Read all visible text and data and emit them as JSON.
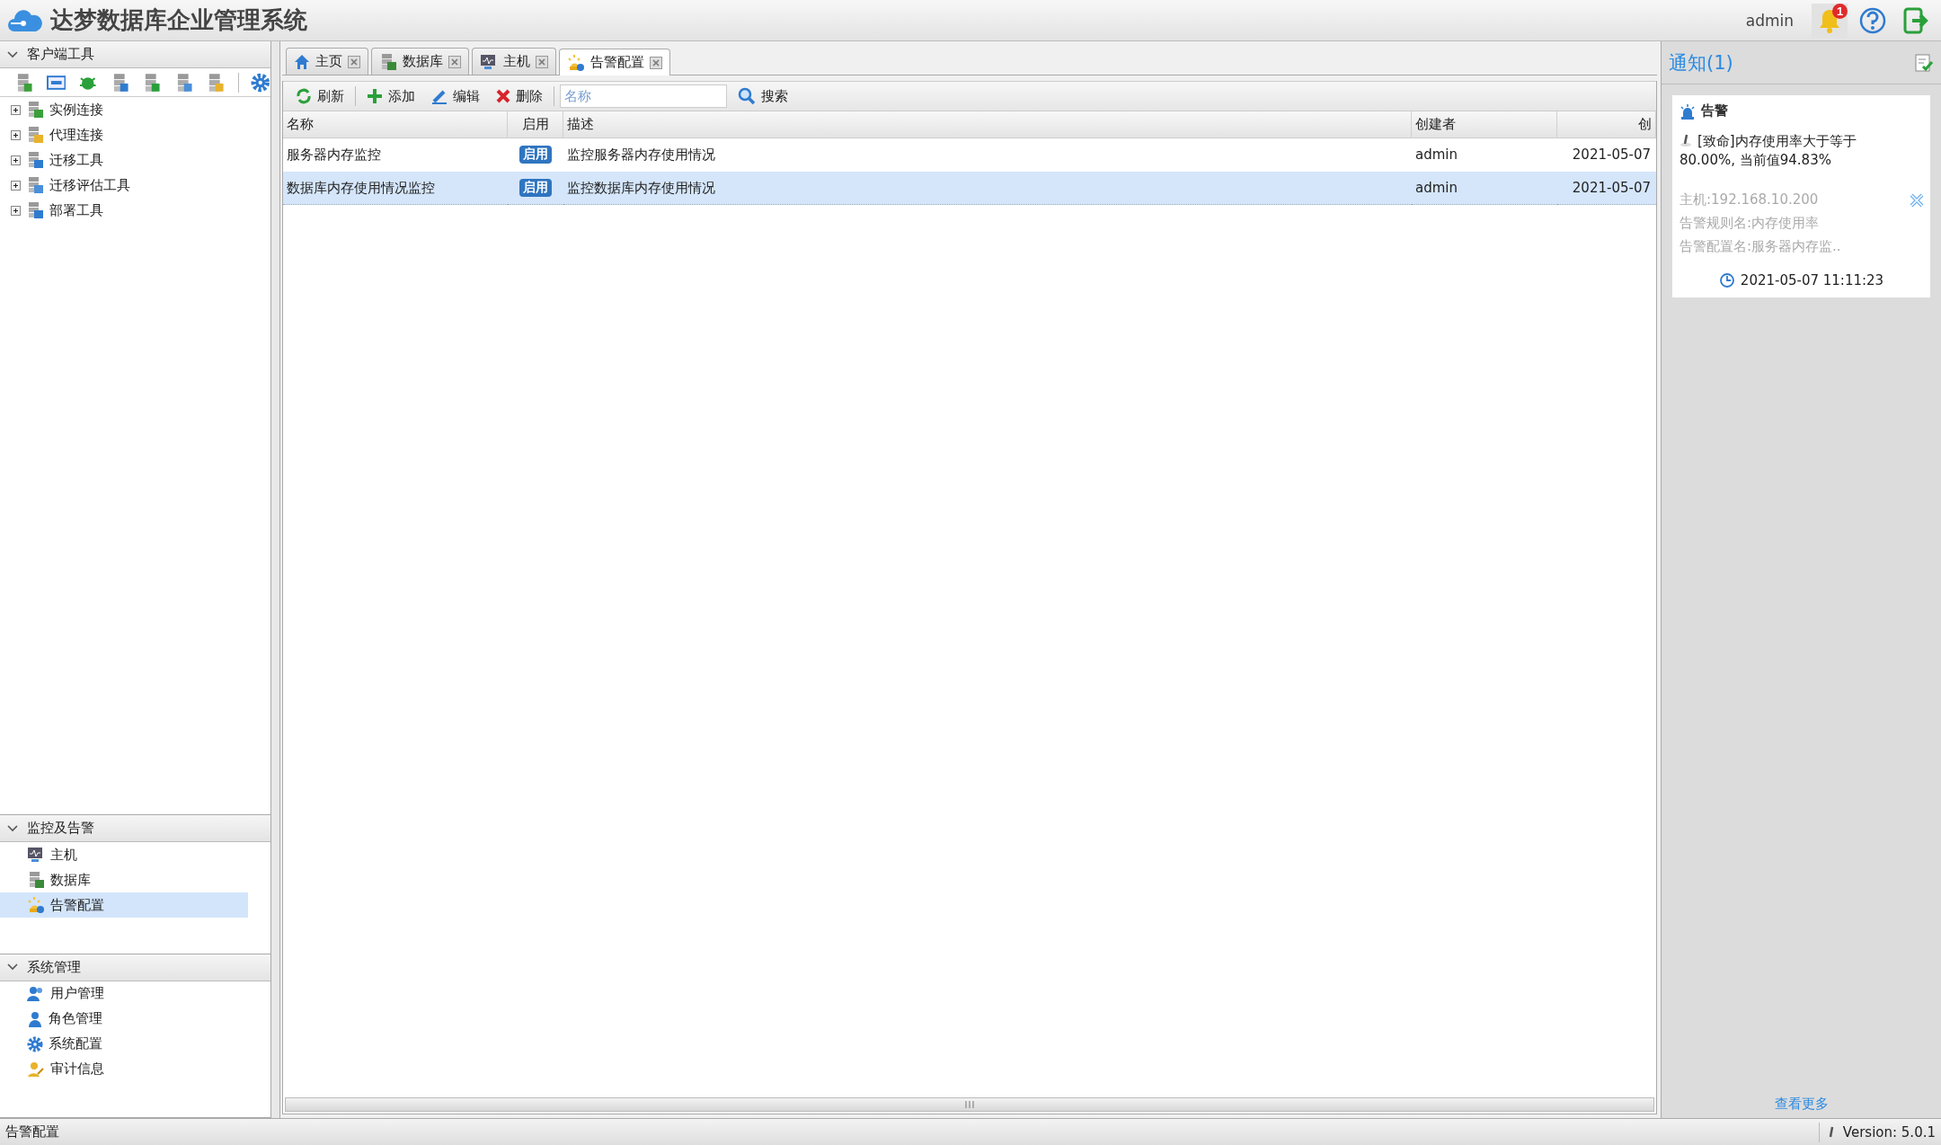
{
  "app": {
    "title": "达梦数据库企业管理系统",
    "user": "admin",
    "notification_count": "1"
  },
  "sidebar": {
    "sections": [
      {
        "title": "客户端工具",
        "kind": "tree",
        "expanded": true,
        "items": [
          {
            "label": "实例连接",
            "expanded": false
          },
          {
            "label": "代理连接",
            "expanded": false
          },
          {
            "label": "迁移工具",
            "expanded": false
          },
          {
            "label": "迁移评估工具",
            "expanded": false
          },
          {
            "label": "部署工具",
            "expanded": false
          }
        ]
      },
      {
        "title": "监控及告警",
        "kind": "list",
        "expanded": true,
        "items": [
          {
            "label": "主机",
            "selected": false
          },
          {
            "label": "数据库",
            "selected": false
          },
          {
            "label": "告警配置",
            "selected": true
          }
        ]
      },
      {
        "title": "系统管理",
        "kind": "list",
        "expanded": true,
        "items": [
          {
            "label": "用户管理",
            "selected": false
          },
          {
            "label": "角色管理",
            "selected": false
          },
          {
            "label": "系统配置",
            "selected": false
          },
          {
            "label": "审计信息",
            "selected": false
          }
        ]
      }
    ]
  },
  "tabs": [
    {
      "label": "主页",
      "selected": false
    },
    {
      "label": "数据库",
      "selected": false
    },
    {
      "label": "主机",
      "selected": false
    },
    {
      "label": "告警配置",
      "selected": true
    }
  ],
  "toolbar": {
    "buttons": [
      "刷新",
      "添加",
      "编辑",
      "删除"
    ],
    "search": {
      "placeholder": "名称"
    },
    "search_button": "搜索"
  },
  "table": {
    "columns": [
      "名称",
      "启用",
      "描述",
      "创建者",
      "创"
    ],
    "rows": [
      {
        "cells": [
          "服务器内存监控",
          "启用",
          "监控服务器内存使用情况",
          "admin",
          "2021-05-07"
        ],
        "selected": false
      },
      {
        "cells": [
          "数据库内存使用情况监控",
          "启用",
          "监控数据库内存使用情况",
          "admin",
          "2021-05-07"
        ],
        "selected": true
      }
    ]
  },
  "notifications": {
    "title": "通知(1)",
    "cards": [
      {
        "category": "告警",
        "message": "[致命]内存使用率大于等于80.00%, 当前值94.83%",
        "details": [
          "主机:192.168.10.200",
          "告警规则名:内存使用率",
          "告警配置名:服务器内存监.."
        ],
        "time": "2021-05-07 11:11:23"
      }
    ],
    "more_link": "查看更多"
  },
  "status_bar": {
    "text": "告警配置",
    "version": "Version: 5.0.1"
  }
}
